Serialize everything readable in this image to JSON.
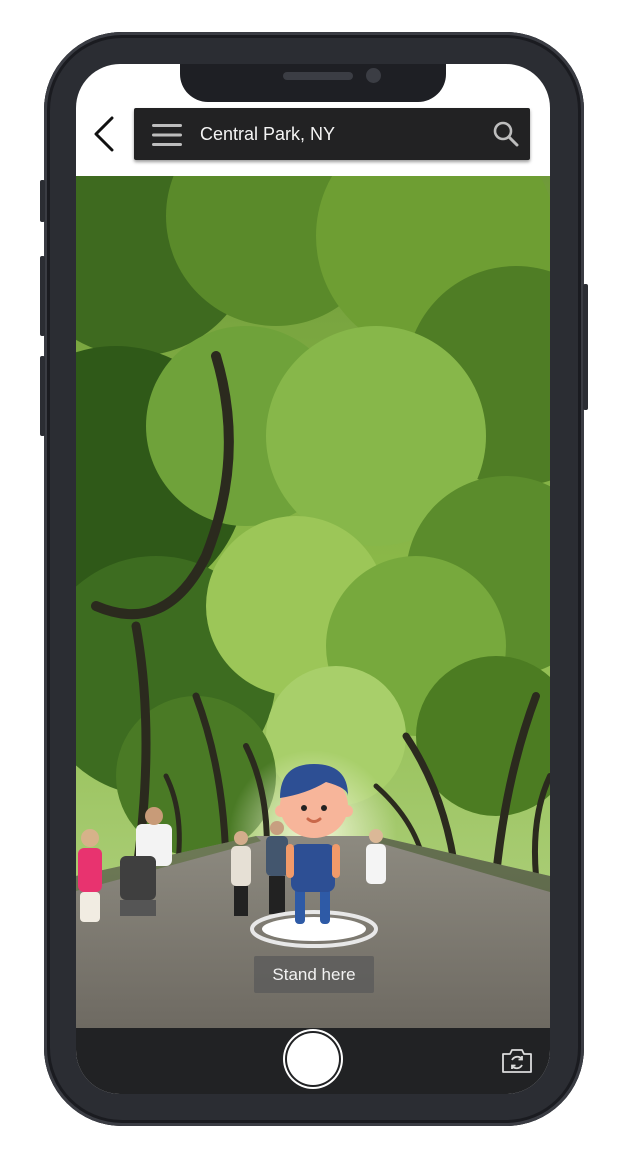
{
  "header": {
    "location": "Central Park, NY"
  },
  "ar": {
    "marker_label": "Stand here"
  },
  "icons": {
    "back": "chevron-left-icon",
    "menu": "hamburger-menu-icon",
    "search": "search-icon",
    "shutter": "shutter-button",
    "flip": "camera-flip-icon"
  },
  "colors": {
    "bar": "#222223",
    "device": "#2b2d33",
    "marker": "#ffffff"
  }
}
